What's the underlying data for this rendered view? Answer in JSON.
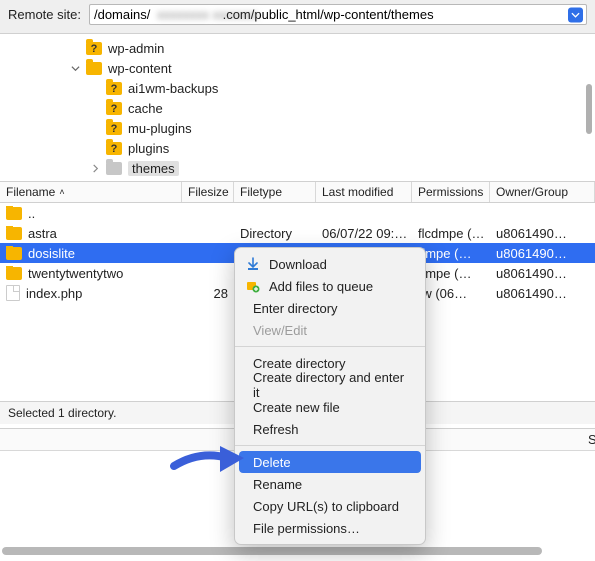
{
  "address": {
    "label": "Remote site:",
    "prefix": "/domains/",
    "obscured": "xxxxxxxx xxxxxxx",
    "suffix": ".com/public_html/wp-content/themes"
  },
  "tree": [
    {
      "level": 0,
      "iconType": "q",
      "label": "wp-admin",
      "disclosure": ""
    },
    {
      "level": 0,
      "iconType": "plain",
      "label": "wp-content",
      "disclosure": "down"
    },
    {
      "level": 1,
      "iconType": "q",
      "label": "ai1wm-backups",
      "disclosure": ""
    },
    {
      "level": 1,
      "iconType": "q",
      "label": "cache",
      "disclosure": ""
    },
    {
      "level": 1,
      "iconType": "q",
      "label": "mu-plugins",
      "disclosure": ""
    },
    {
      "level": 1,
      "iconType": "q",
      "label": "plugins",
      "disclosure": ""
    },
    {
      "level": 1,
      "iconType": "grey",
      "label": "themes",
      "disclosure": "right",
      "selected": true
    }
  ],
  "columns": {
    "name": "Filename",
    "size": "Filesize",
    "type": "Filetype",
    "mod": "Last modified",
    "perm": "Permissions",
    "own": "Owner/Group"
  },
  "files": [
    {
      "name": "..",
      "icon": "folder",
      "size": "",
      "type": "",
      "mod": "",
      "perm": "",
      "own": ""
    },
    {
      "name": "astra",
      "icon": "folder",
      "size": "",
      "type": "Directory",
      "mod": "06/07/22 09:…",
      "perm": "flcdmpe (…",
      "own": "u8061490…"
    },
    {
      "name": "dosislite",
      "icon": "folder",
      "size": "",
      "type": "",
      "mod": "",
      "perm": "dmpe (…",
      "own": "u8061490…",
      "selected": true
    },
    {
      "name": "twentytwentytwo",
      "icon": "folder",
      "size": "",
      "type": "",
      "mod": "",
      "perm": "dmpe (…",
      "own": "u8061490…"
    },
    {
      "name": "index.php",
      "icon": "file",
      "size": "28",
      "type": "",
      "mod": "",
      "perm": "rw (06…",
      "own": "u8061490…"
    }
  ],
  "status": "Selected 1 directory.",
  "lowerColumn": "Siz",
  "contextMenu": [
    {
      "kind": "item",
      "label": "Download",
      "icon": "download-icon"
    },
    {
      "kind": "item",
      "label": "Add files to queue",
      "icon": "queue-add-icon"
    },
    {
      "kind": "item",
      "label": "Enter directory"
    },
    {
      "kind": "item",
      "label": "View/Edit",
      "disabled": true
    },
    {
      "kind": "sep"
    },
    {
      "kind": "item",
      "label": "Create directory"
    },
    {
      "kind": "item",
      "label": "Create directory and enter it"
    },
    {
      "kind": "item",
      "label": "Create new file"
    },
    {
      "kind": "item",
      "label": "Refresh"
    },
    {
      "kind": "sep"
    },
    {
      "kind": "item",
      "label": "Delete",
      "highlight": true
    },
    {
      "kind": "item",
      "label": "Rename"
    },
    {
      "kind": "item",
      "label": "Copy URL(s) to clipboard"
    },
    {
      "kind": "item",
      "label": "File permissions…"
    }
  ]
}
